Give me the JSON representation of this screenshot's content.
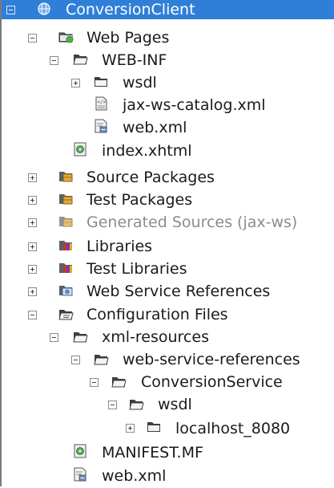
{
  "tree": {
    "root": {
      "label": "ConversionClient",
      "icon": "globe-project-icon"
    },
    "web_pages": {
      "label": "Web Pages",
      "icon": "web-folder-icon"
    },
    "web_inf": {
      "label": "WEB-INF",
      "icon": "folder-open-icon"
    },
    "wsdl": {
      "label": "wsdl",
      "icon": "folder-closed-icon"
    },
    "jax_ws_catalog": {
      "label": "jax-ws-catalog.xml",
      "icon": "xml-file-icon"
    },
    "web_xml_1": {
      "label": "web.xml",
      "icon": "config-file-icon"
    },
    "index_xhtml": {
      "label": "index.xhtml",
      "icon": "html-file-icon"
    },
    "source_packages": {
      "label": "Source Packages",
      "icon": "package-folder-icon"
    },
    "test_packages": {
      "label": "Test Packages",
      "icon": "package-folder-icon"
    },
    "generated_sources": {
      "label": "Generated Sources (jax-ws)",
      "icon": "package-folder-icon"
    },
    "libraries": {
      "label": "Libraries",
      "icon": "library-icon"
    },
    "test_libraries": {
      "label": "Test Libraries",
      "icon": "library-icon"
    },
    "web_service_references": {
      "label": "Web Service References",
      "icon": "web-service-icon"
    },
    "configuration_files": {
      "label": "Configuration Files",
      "icon": "config-folder-icon"
    },
    "xml_resources": {
      "label": "xml-resources",
      "icon": "folder-open-icon"
    },
    "web_service_refs": {
      "label": "web-service-references",
      "icon": "folder-open-icon"
    },
    "conversion_service": {
      "label": "ConversionService",
      "icon": "folder-open-icon"
    },
    "wsdl_2": {
      "label": "wsdl",
      "icon": "folder-open-icon"
    },
    "localhost": {
      "label": "localhost_8080",
      "icon": "folder-closed-icon"
    },
    "manifest": {
      "label": "MANIFEST.MF",
      "icon": "manifest-file-icon"
    },
    "web_xml_2": {
      "label": "web.xml",
      "icon": "config-file-icon"
    }
  },
  "colors": {
    "selection": "#2f7fd8",
    "disabled_text": "#8c8c8c"
  }
}
